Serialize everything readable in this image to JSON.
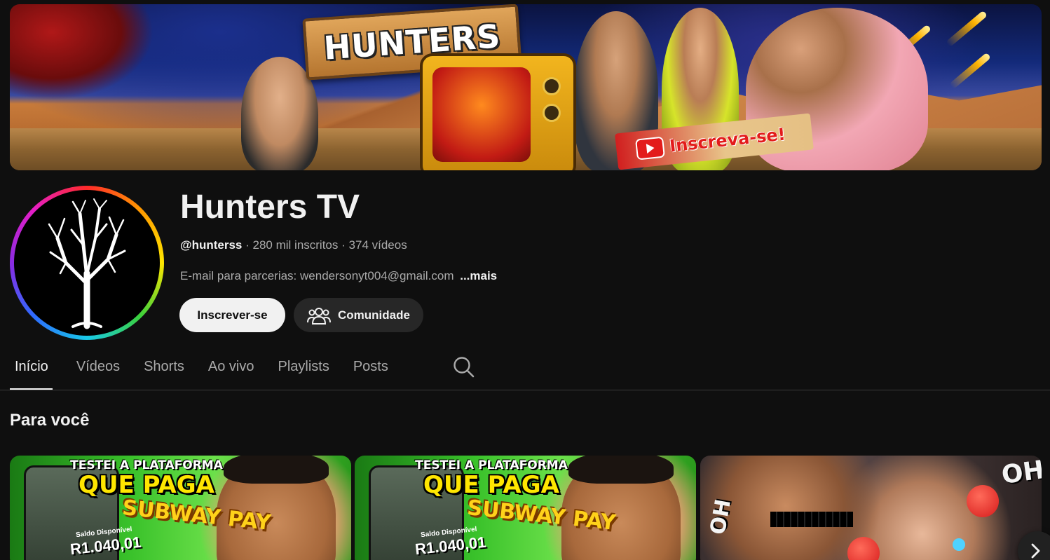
{
  "banner": {
    "sign_text": "HUNTERS",
    "tag_text": "Inscreva-se!"
  },
  "channel": {
    "name": "Hunters TV",
    "handle": "@hunterss",
    "subscribers": "280 mil inscritos",
    "videos": "374 vídeos",
    "separator": "·",
    "description": "E-mail para parcerias: wendersonyt004@gmail.com",
    "more_label": "...mais"
  },
  "actions": {
    "subscribe_label": "Inscrever-se",
    "community_label": "Comunidade"
  },
  "tabs": [
    {
      "label": "Início",
      "active": true
    },
    {
      "label": "Vídeos",
      "active": false
    },
    {
      "label": "Shorts",
      "active": false
    },
    {
      "label": "Ao vivo",
      "active": false
    },
    {
      "label": "Playlists",
      "active": false
    },
    {
      "label": "Posts",
      "active": false
    }
  ],
  "section": {
    "title": "Para você"
  },
  "videos": [
    {
      "headline_1": "TESTEI A PLATAFORMA",
      "headline_2": "QUE PAGA",
      "game": "SUBWAY PAY",
      "balance_label": "Saldo Disponível",
      "balance": "R1.040,01"
    },
    {
      "headline_1": "TESTEI A PLATAFORMA",
      "headline_2": "QUE PAGA",
      "game": "SUBWAY PAY",
      "balance_label": "Saldo Disponível",
      "balance": "R1.040,01"
    },
    {
      "overlay_1": "OH",
      "overlay_2": "OH"
    }
  ],
  "icons": {
    "community": "people-icon",
    "search": "search-icon",
    "next": "chevron-right-icon",
    "avatar": "tree-icon"
  },
  "colors": {
    "background": "#0f0f0f",
    "text_primary": "#f1f1f1",
    "text_secondary": "#aaaaaa",
    "subscribe_bg": "#f1f1f1",
    "community_bg": "#272727"
  }
}
